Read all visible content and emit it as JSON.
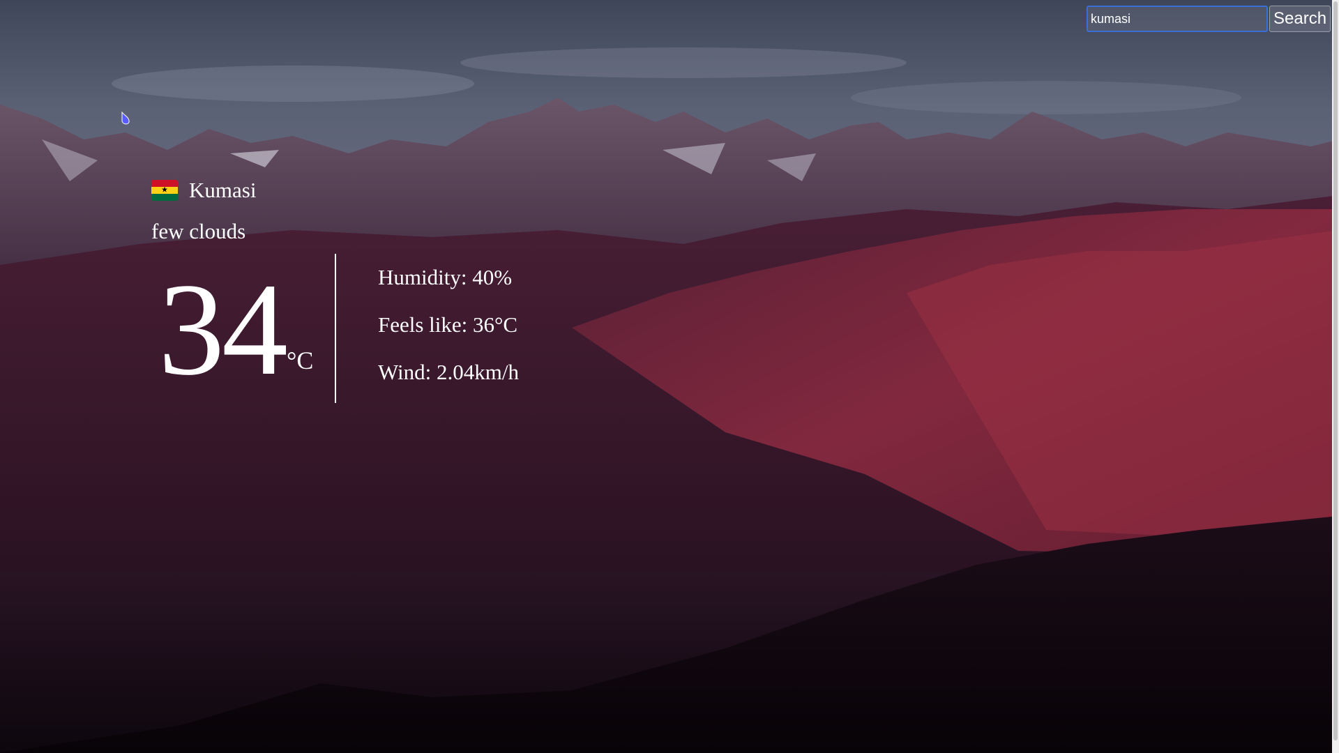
{
  "search": {
    "value": "kumasi",
    "button_label": "Search"
  },
  "weather": {
    "city": "Kumasi",
    "country_flag": "ghana-flag-icon",
    "description": "few clouds",
    "temperature": "34",
    "unit": "°C",
    "humidity_text": "Humidity: 40%",
    "feels_like_text": "Feels like: 36°C",
    "wind_text": "Wind: 2.04km/h"
  },
  "colors": {
    "flag_red": "#ce1126",
    "flag_gold": "#fcd116",
    "flag_green": "#006b3f",
    "focus_ring": "#3b6fd8",
    "text": "#ffffff"
  }
}
